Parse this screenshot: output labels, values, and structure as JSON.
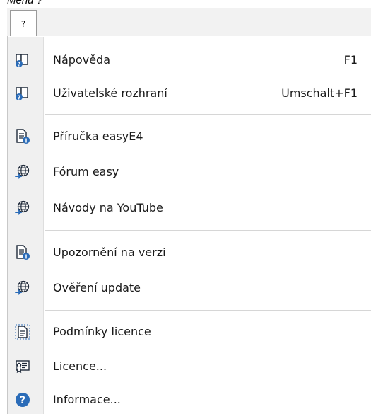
{
  "caption": "Menu ?",
  "menubar": {
    "tab_label": "?"
  },
  "menu": {
    "items": [
      {
        "label": "Nápověda",
        "shortcut": "F1",
        "icon": "help-book-icon"
      },
      {
        "label": "Uživatelské rozhraní",
        "shortcut": "Umschalt+F1",
        "icon": "help-book-icon"
      },
      {
        "label": "Příručka easyE4",
        "icon": "document-info-icon"
      },
      {
        "label": "Fórum easy",
        "icon": "globe-link-icon"
      },
      {
        "label": "Návody na YouTube",
        "icon": "globe-link-icon"
      },
      {
        "label": "Upozornění na verzi",
        "icon": "document-info-icon"
      },
      {
        "label": "Ověření update",
        "icon": "globe-link-icon"
      },
      {
        "label": "Podmínky licence",
        "icon": "license-document-icon"
      },
      {
        "label": "Licence...",
        "icon": "certificate-icon"
      },
      {
        "label": "Informace...",
        "icon": "question-circle-icon"
      }
    ]
  },
  "colors": {
    "icon_blue": "#2b6cb8",
    "icon_dark": "#1f2a3a",
    "gutter": "#f0f0f0"
  }
}
